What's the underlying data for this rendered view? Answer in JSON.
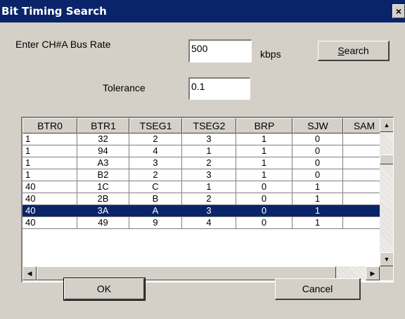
{
  "window": {
    "title": "Bit Timing Search",
    "close_glyph": "×"
  },
  "form": {
    "bus_rate_label": "Enter CH#A Bus Rate",
    "bus_rate_value": "500",
    "bus_rate_unit": "kbps",
    "tolerance_label": "Tolerance",
    "tolerance_value": "0.1",
    "search_button": {
      "mnemonic": "S",
      "rest": "earch"
    }
  },
  "table": {
    "columns": [
      "BTR0",
      "BTR1",
      "TSEG1",
      "TSEG2",
      "BRP",
      "SJW",
      "SAM"
    ],
    "rows": [
      {
        "cells": [
          "1",
          "32",
          "2",
          "3",
          "1",
          "0",
          ""
        ],
        "selected": false
      },
      {
        "cells": [
          "1",
          "94",
          "4",
          "1",
          "1",
          "0",
          ""
        ],
        "selected": false
      },
      {
        "cells": [
          "1",
          "A3",
          "3",
          "2",
          "1",
          "0",
          ""
        ],
        "selected": false
      },
      {
        "cells": [
          "1",
          "B2",
          "2",
          "3",
          "1",
          "0",
          ""
        ],
        "selected": false
      },
      {
        "cells": [
          "40",
          "1C",
          "C",
          "1",
          "0",
          "1",
          ""
        ],
        "selected": false
      },
      {
        "cells": [
          "40",
          "2B",
          "B",
          "2",
          "0",
          "1",
          ""
        ],
        "selected": false
      },
      {
        "cells": [
          "40",
          "3A",
          "A",
          "3",
          "0",
          "1",
          ""
        ],
        "selected": true
      },
      {
        "cells": [
          "40",
          "49",
          "9",
          "4",
          "0",
          "1",
          ""
        ],
        "selected": false
      }
    ]
  },
  "buttons": {
    "ok": "OK",
    "cancel": "Cancel"
  },
  "icons": {
    "scroll_up": "up-arrow-icon",
    "scroll_down": "down-arrow-icon",
    "scroll_left": "left-arrow-icon",
    "scroll_right": "right-arrow-icon"
  },
  "colors": {
    "title_bar": "#0a246a",
    "selection": "#0a246a",
    "dialog_face": "#d4d0c8"
  }
}
